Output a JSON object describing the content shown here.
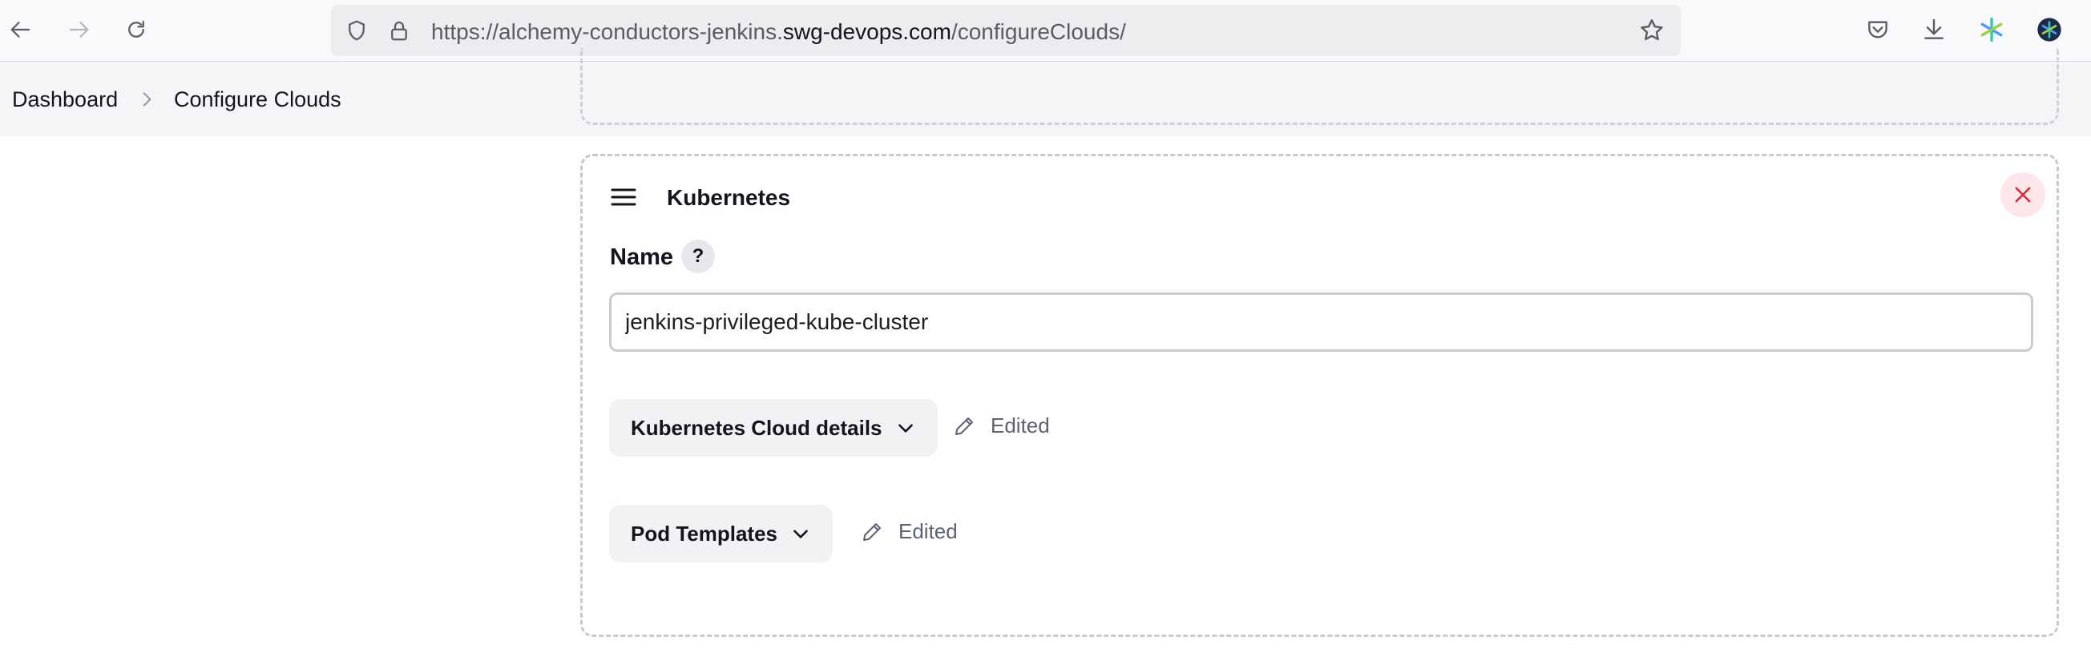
{
  "browser": {
    "url_prefix": "https://alchemy-conductors-jenkins.",
    "url_domain": "swg-devops.com",
    "url_path": "/configureClouds/",
    "icons": {
      "back": "back-arrow-icon",
      "forward": "forward-arrow-icon",
      "reload": "reload-icon",
      "shield": "tracking-shield-icon",
      "lock": "lock-icon",
      "bookmark": "bookmark-star-icon",
      "pocket": "pocket-icon",
      "downloads": "download-icon",
      "extension": "extension-icon",
      "account": "account-icon"
    }
  },
  "breadcrumb": {
    "items": [
      {
        "label": "Dashboard"
      },
      {
        "label": "Configure Clouds"
      }
    ]
  },
  "cloud_card": {
    "title": "Kubernetes",
    "name_label": "Name",
    "help_label": "?",
    "name_value": "jenkins-privileged-kube-cluster",
    "sections": [
      {
        "label": "Kubernetes Cloud details",
        "status": "Edited"
      },
      {
        "label": "Pod Templates",
        "status": "Edited"
      }
    ]
  },
  "colors": {
    "close_bg": "#fde7ea",
    "close_icon": "#d92d3f",
    "section_bg": "#f2f2f5",
    "edited_text": "#5e6173"
  }
}
